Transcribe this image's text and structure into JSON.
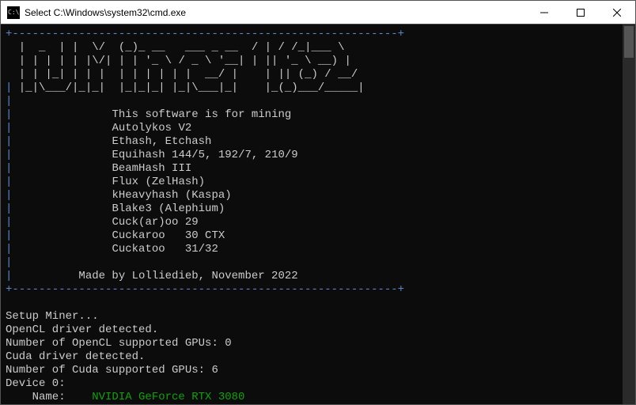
{
  "title": "Select C:\\Windows\\system32\\cmd.exe",
  "ascii_art": " |  _  | |  \\/  (_)_ __   ___ _ __  / | / /_|___ \\\n | | | | | |\\/| | | '_ \\ / _ \\ '__| | || '_ \\ __) |\n | | |_| | | |  | | | | | |  __/ |    | || (_) / __/\n |_|\\___/|_|_|  |_|_|_| |_|\\___|_|    |_(_)___/_____|",
  "intro": "This software is for mining",
  "algos": [
    "Autolykos V2",
    "Ethash, Etchash",
    "Equihash 144/5, 192/7, 210/9",
    "BeamHash III",
    "Flux (ZelHash)",
    "kHeavyhash (Kaspa)",
    "Blake3 (Alephium)",
    "Cuck(ar)oo 29",
    "Cuckaroo   30 CTX",
    "Cuckatoo   31/32"
  ],
  "made_by": "Made by Lolliedieb, November 2022",
  "setup": {
    "l1": "Setup Miner...",
    "l2": "OpenCL driver detected.",
    "l3": "Number of OpenCL supported GPUs: 0",
    "l4": "Cuda driver detected.",
    "l5": "Number of Cuda supported GPUs: 6",
    "l6": "Device 0:",
    "name_label": "    Name:    ",
    "gpu": "NVIDIA GeForce RTX 3080"
  },
  "dash": "+----------------------------------------------------------+",
  "pipe": "|",
  "pipe_close": "                                                          |",
  "indent1": "          ",
  "indent2": "               "
}
